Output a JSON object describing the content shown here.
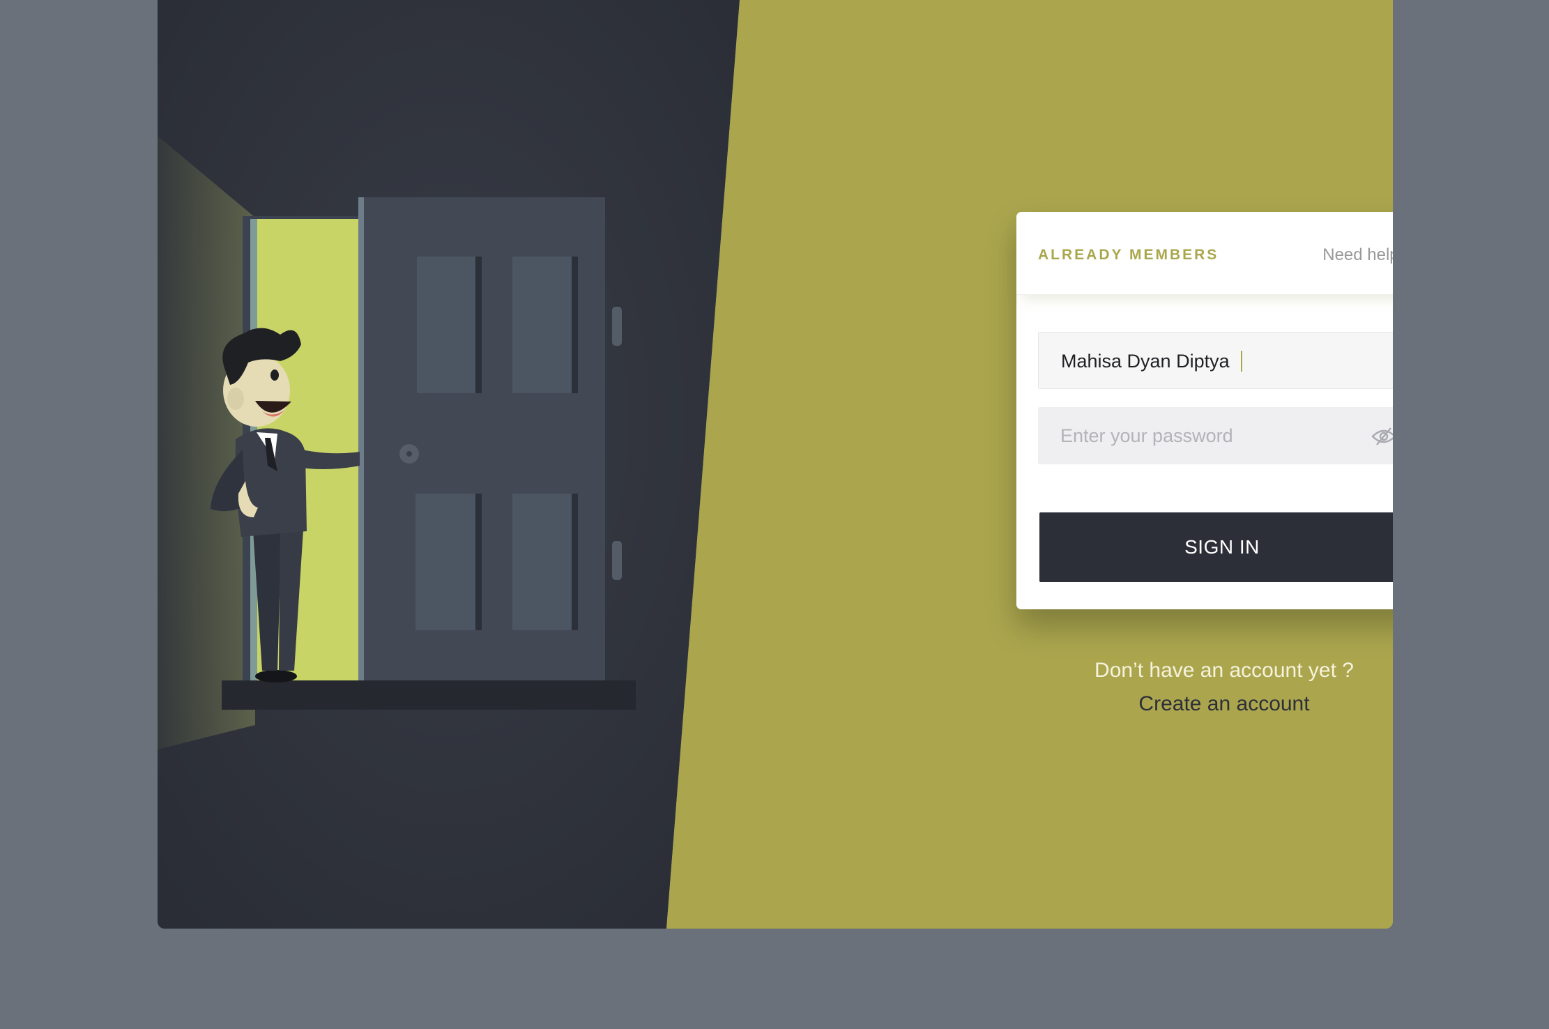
{
  "colors": {
    "page_background": "#6b717a",
    "dark_panel": "#2c2f38",
    "accent_olive": "#a9a64b",
    "door_light": "#c9d467",
    "card_background": "#ffffff"
  },
  "login_card": {
    "title": "ALREADY MEMBERS",
    "help_link": "Need help?",
    "username": {
      "value": "Mahisa Dyan Diptya"
    },
    "password": {
      "value": "",
      "placeholder": "Enter your password",
      "toggle_icon": "eye-slash-icon"
    },
    "submit_label": "SIGN IN"
  },
  "signup": {
    "prompt": "Don’t have an account yet ?",
    "link_label": "Create an account"
  }
}
